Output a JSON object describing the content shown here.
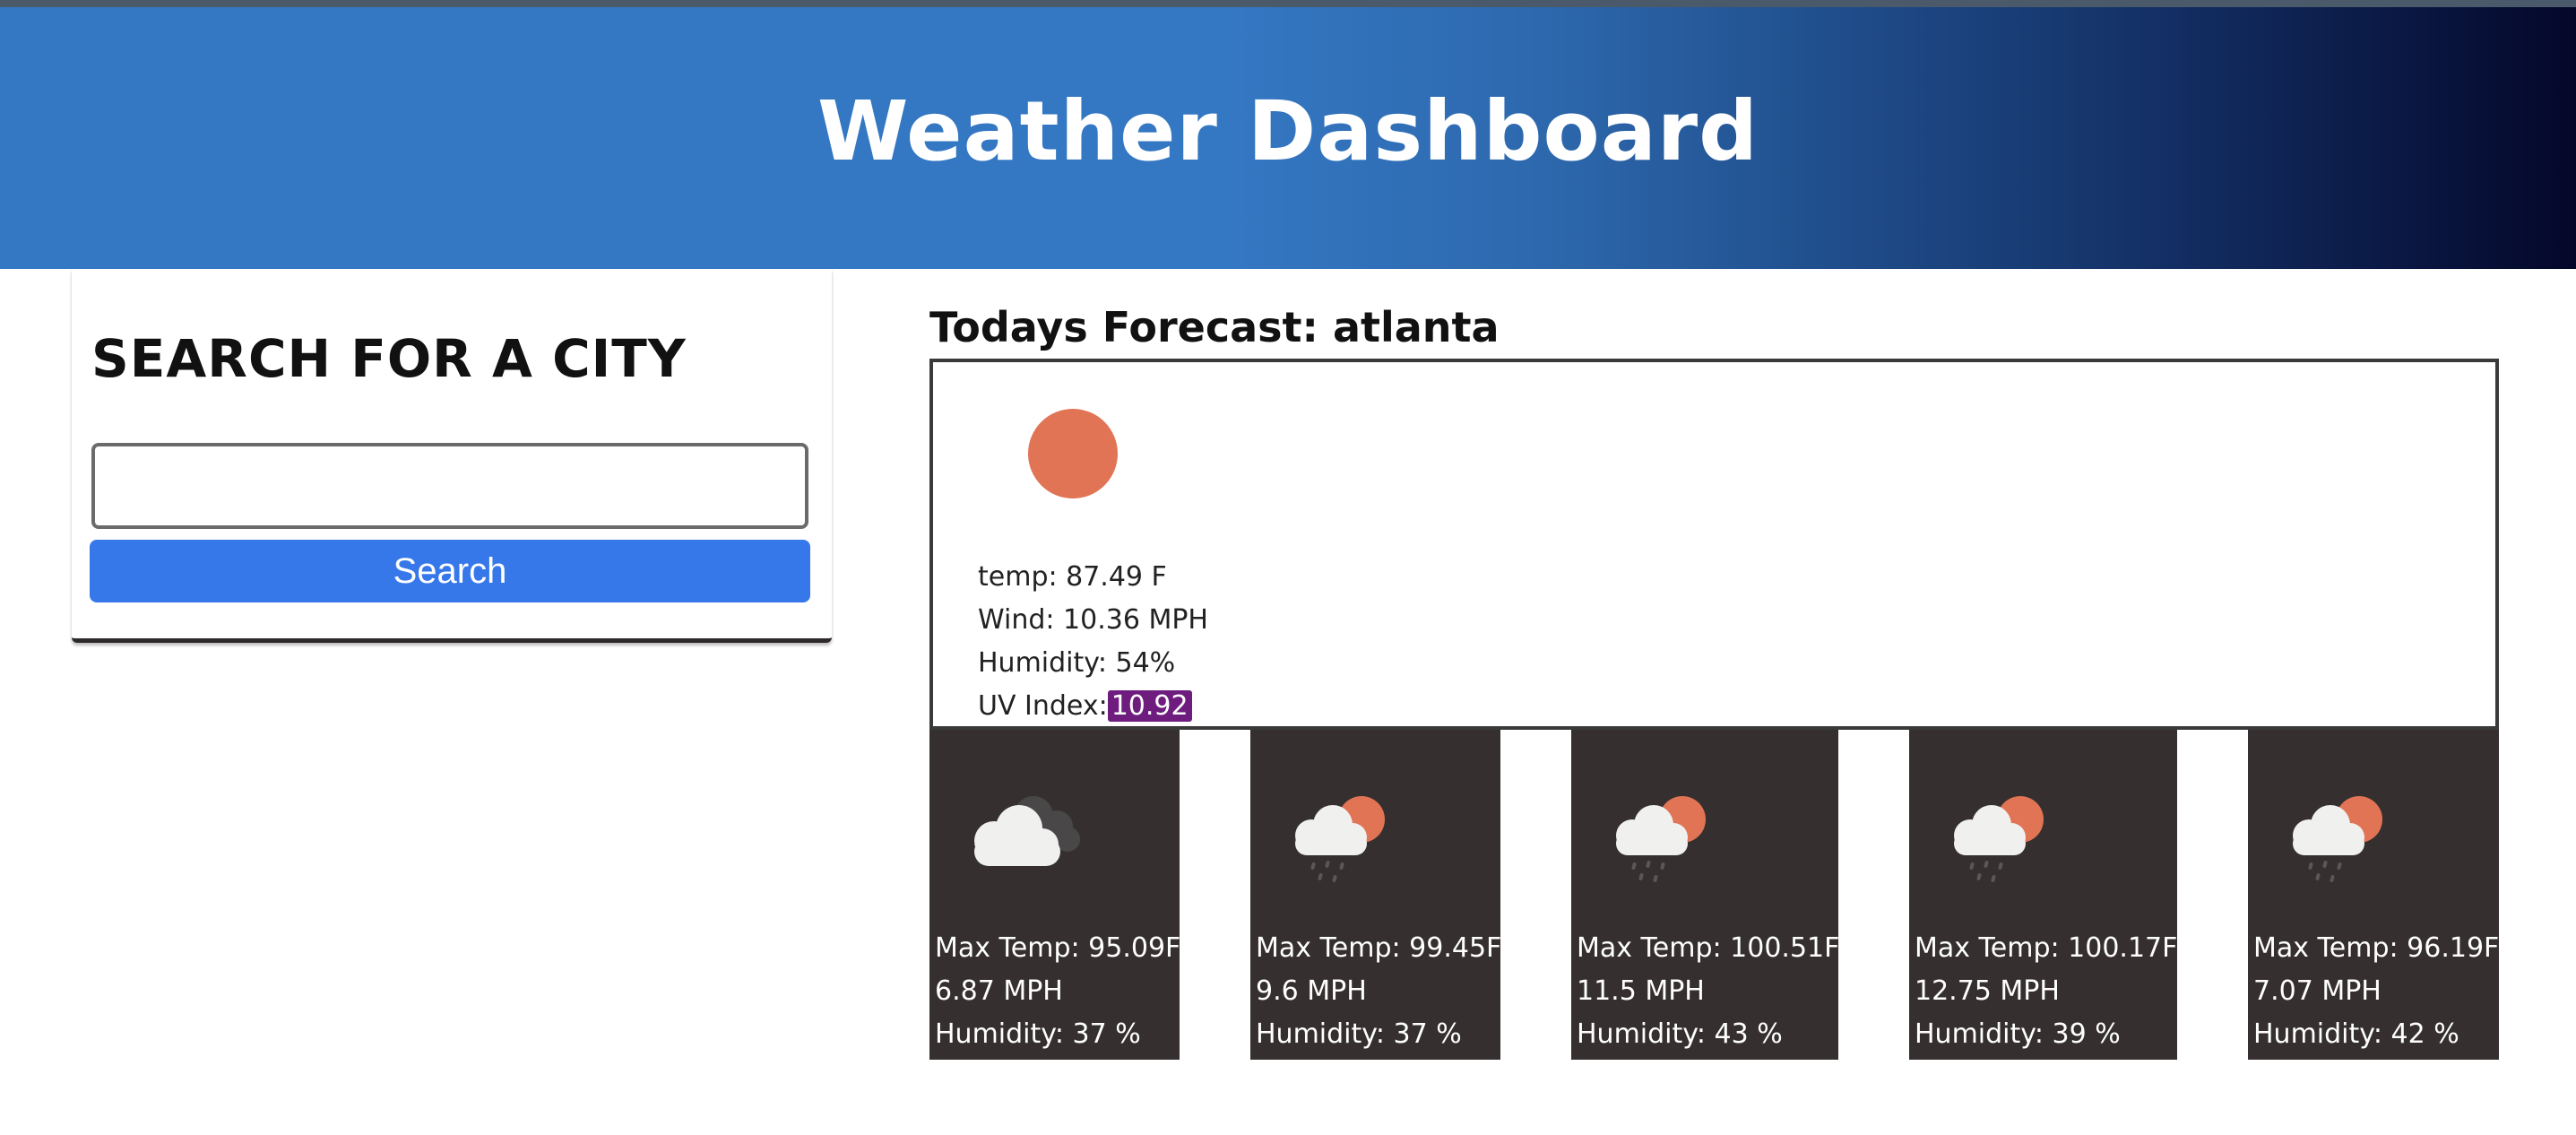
{
  "header": {
    "title": "Weather Dashboard"
  },
  "search": {
    "title": "SEARCH FOR A CITY",
    "input_value": "",
    "placeholder": "",
    "button_label": "Search"
  },
  "today": {
    "title": "Todays Forecast: atlanta",
    "icon": "sun-icon",
    "temp": "temp: 87.49 F",
    "wind": "Wind: 10.36 MPH",
    "humidity": "Humidity: 54%",
    "uv_label": "UV Index:",
    "uv_value": "10.92"
  },
  "forecast": [
    {
      "icon": "cloudy-icon",
      "max_temp": "Max Temp: 95.09F",
      "wind": "6.87 MPH",
      "humidity": "Humidity: 37 %"
    },
    {
      "icon": "sun-rain-cloud-icon",
      "max_temp": "Max Temp: 99.45F",
      "wind": "9.6 MPH",
      "humidity": "Humidity: 37 %"
    },
    {
      "icon": "sun-rain-cloud-icon",
      "max_temp": "Max Temp: 100.51F",
      "wind": "11.5 MPH",
      "humidity": "Humidity: 43 %"
    },
    {
      "icon": "sun-rain-cloud-icon",
      "max_temp": "Max Temp: 100.17F",
      "wind": "12.75 MPH",
      "humidity": "Humidity: 39 %"
    },
    {
      "icon": "sun-rain-cloud-icon",
      "max_temp": "Max Temp: 96.19F",
      "wind": "7.07 MPH",
      "humidity": "Humidity: 42 %"
    }
  ],
  "colors": {
    "header_blue": "#3477c2",
    "header_dark": "#04072a",
    "button_blue": "#3677ea",
    "card_dark": "#35302f",
    "uv_purple": "#6e1d7f",
    "sun_orange": "#e07454"
  }
}
